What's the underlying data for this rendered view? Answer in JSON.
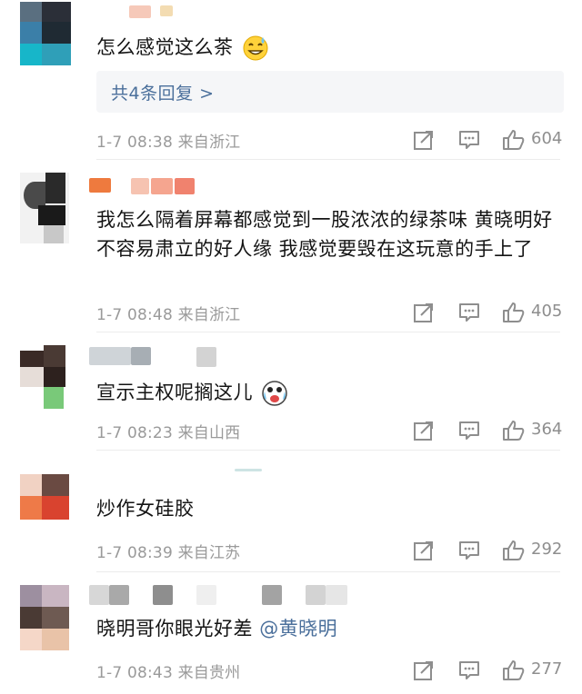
{
  "comments": [
    {
      "text": "怎么感觉这么茶",
      "emoji": "sweat-smile-emoji",
      "time": "1-7 08:38",
      "location": "来自浙江",
      "likes": "604",
      "reply_label": "共4条回复 >"
    },
    {
      "text": "我怎么隔着屏幕都感觉到一股浓浓的绿茶味 黄晓明好不容易肃立的好人缘 我感觉要毁在这玩意的手上了",
      "time": "1-7 08:48",
      "location": "来自浙江",
      "likes": "405"
    },
    {
      "text": "宣示主权呢搁这儿",
      "emoji": "crying-laughing-emoji",
      "time": "1-7 08:23",
      "location": "来自山西",
      "likes": "364"
    },
    {
      "text": "炒作女硅胶",
      "time": "1-7 08:39",
      "location": "来自江苏",
      "likes": "292"
    },
    {
      "text": "晓明哥你眼光好差 ",
      "mention": "@黄晓明",
      "time": "1-7 08:43",
      "location": "来自贵州",
      "likes": "277"
    }
  ],
  "icons": {
    "share": "share-icon",
    "comment": "comment-icon",
    "like": "thumbs-up-icon"
  },
  "colors": {
    "link": "#4a6f9b",
    "meta": "#9a9a9a",
    "reply_bg": "#f5f6f8"
  }
}
